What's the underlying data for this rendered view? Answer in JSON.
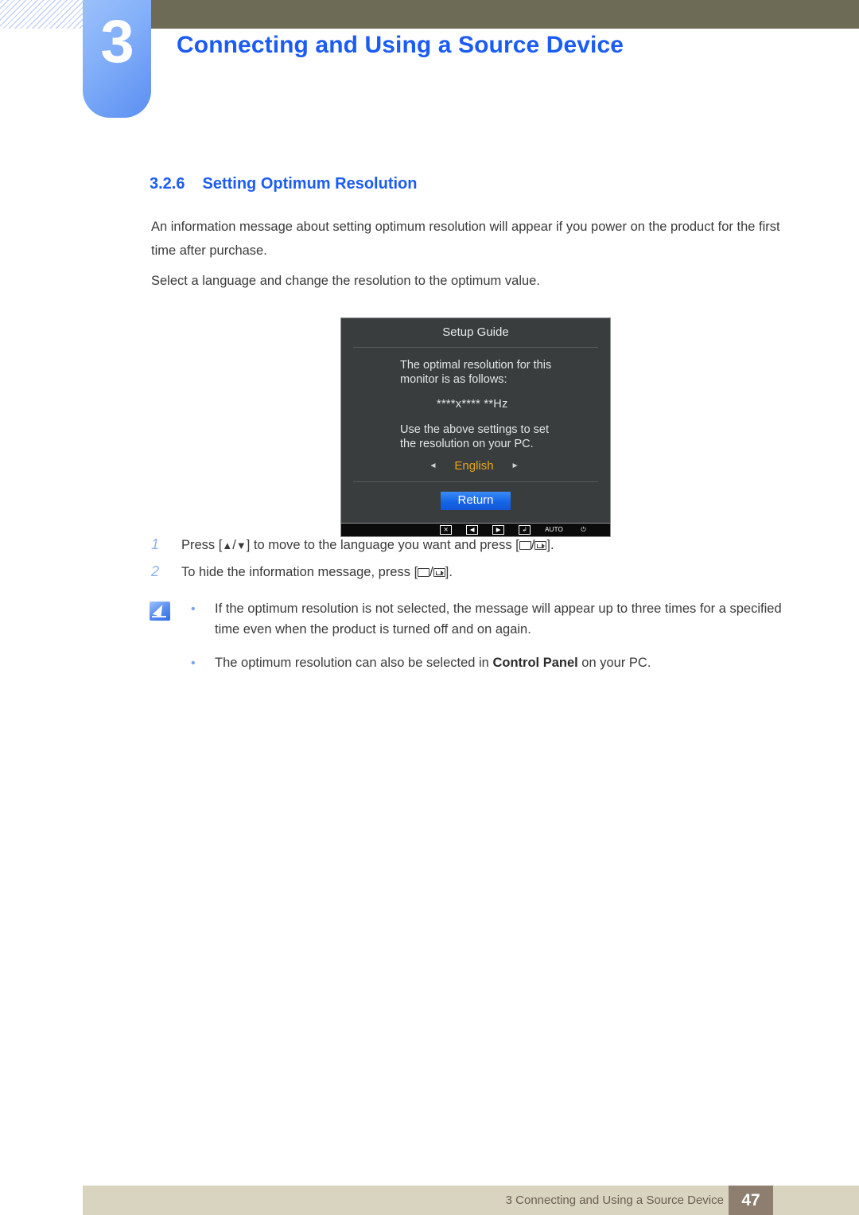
{
  "header": {
    "chapter_number": "3",
    "chapter_title": "Connecting and Using a Source Device"
  },
  "section": {
    "number": "3.2.6",
    "title": "Setting Optimum Resolution"
  },
  "paragraphs": {
    "p1": "An information message about setting optimum resolution will appear if you power on the product for the first time after purchase.",
    "p2": "Select a language and change the resolution to the optimum value."
  },
  "osd": {
    "title": "Setup Guide",
    "line1": "The optimal resolution for this",
    "line2": "monitor is as follows:",
    "resolution": "****x****  **Hz",
    "line3": "Use the above settings to set",
    "line4": "the resolution on your PC.",
    "left_arrow": "◄",
    "language": "English",
    "right_arrow": "►",
    "return_label": "Return",
    "buttons": [
      {
        "name": "close-key",
        "glyph": "✕"
      },
      {
        "name": "left-key",
        "glyph": "◀"
      },
      {
        "name": "right-key",
        "glyph": "▶"
      },
      {
        "name": "enter-key",
        "glyph": "↲"
      },
      {
        "name": "auto-key",
        "glyph": "AUTO"
      },
      {
        "name": "power-key",
        "glyph": "⏻"
      }
    ]
  },
  "steps": [
    {
      "number": "1",
      "text_a": "Press [",
      "up": "▲",
      "slash1": "/",
      "down": "▼",
      "text_b": "] to move to the language you want and press [",
      "slash2": "/",
      "text_c": "]."
    },
    {
      "number": "2",
      "text_a": "To hide the information message, press [",
      "slash2": "/",
      "text_c": "]."
    }
  ],
  "notes": {
    "bullet": "•",
    "items": [
      {
        "pre": "If the optimum resolution is not selected, the message will appear up to three times for a specified time even when the product is turned off and on again.",
        "bold": "",
        "post": ""
      },
      {
        "pre": "The optimum resolution can also be selected in ",
        "bold": "Control Panel",
        "post": " on your PC."
      }
    ]
  },
  "footer": {
    "text": "3 Connecting and Using a Source Device",
    "page_number": "47"
  },
  "colors": {
    "accent_blue": "#1a5cf5",
    "olive": "#6d6b56",
    "footer_band": "#d9d4bf",
    "footer_page_box": "#8d7e70",
    "osd_background": "#393d3e",
    "osd_highlight": "#e8a51d",
    "osd_button_blue": "#1565e8"
  }
}
